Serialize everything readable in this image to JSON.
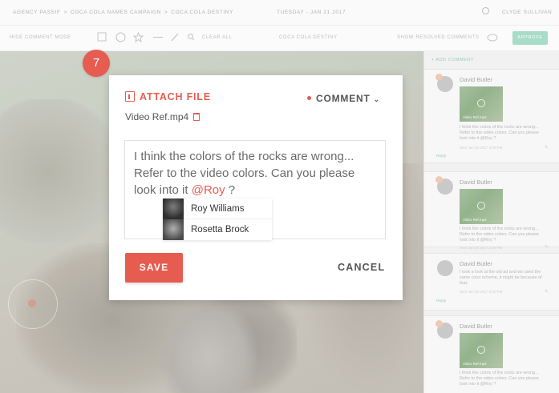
{
  "topbar": {
    "crumb_1": "AGENCY PASSIF",
    "crumb_2": "COCA COLA NAMES CAMPAIGN",
    "crumb_3": "COCA COLA DESTINY",
    "separator": ">",
    "date": "TUESDAY - JAN 21 2017",
    "user": "CLYDE SULLIVAN"
  },
  "toolbar": {
    "hide_mode": "HIDE COMMENT MODE",
    "clear_all": "CLEAR ALL",
    "project": "COCA COLA DESTINY",
    "show_resolved": "SHOW RESOLVED COMMENTS",
    "approve": "APPROVE"
  },
  "step": "7",
  "modal": {
    "attach_label": "ATTACH FILE",
    "type_label": "COMMENT",
    "file_name": "Video Ref.mp4",
    "message_text": "I think the colors of the rocks are wrong... Refer to the video colors. Can you please look into it ",
    "mention": "@Roy",
    "message_end": " ?",
    "suggestions": [
      "Roy Williams",
      "Rosetta Brock"
    ],
    "save_label": "SAVE",
    "cancel_label": "CANCEL"
  },
  "sidebar": {
    "add_comment": "+ ADD COMMENT",
    "comments": [
      {
        "author": "David Butler",
        "thumb_caption": "Video Ref.mp4",
        "text": "I think the colors of the rocks are wrong... Refer to the video colors. Can you please look into it @Roy ?",
        "time": "Sent Jan 26 2017 3:00 PM",
        "reply": "Reply"
      },
      {
        "author": "David Butler",
        "thumb_caption": "Video Ref.mp4",
        "text": "I think the colors of the rocks are wrong... Refer to the video colors. Can you please look into it @Roy ?",
        "time": "Sent Jan 26 2017 3:00 PM",
        "reply": ""
      },
      {
        "author": "David Butler",
        "thumb_caption": "",
        "text": "I took a look at the old ad and we used the same color scheme, it might be because of that.",
        "time": "Sent Jan 26 2017 3:00 PM",
        "reply": "Reply"
      },
      {
        "author": "David Butler",
        "thumb_caption": "Video Ref.mp4",
        "text": "I think the colors of the rocks are wrong... Refer to the video colors. Can you please look into it @Roy ?",
        "time": "",
        "reply": ""
      }
    ]
  },
  "colors": {
    "accent": "#e65c50",
    "approve": "#a8dcc8"
  }
}
